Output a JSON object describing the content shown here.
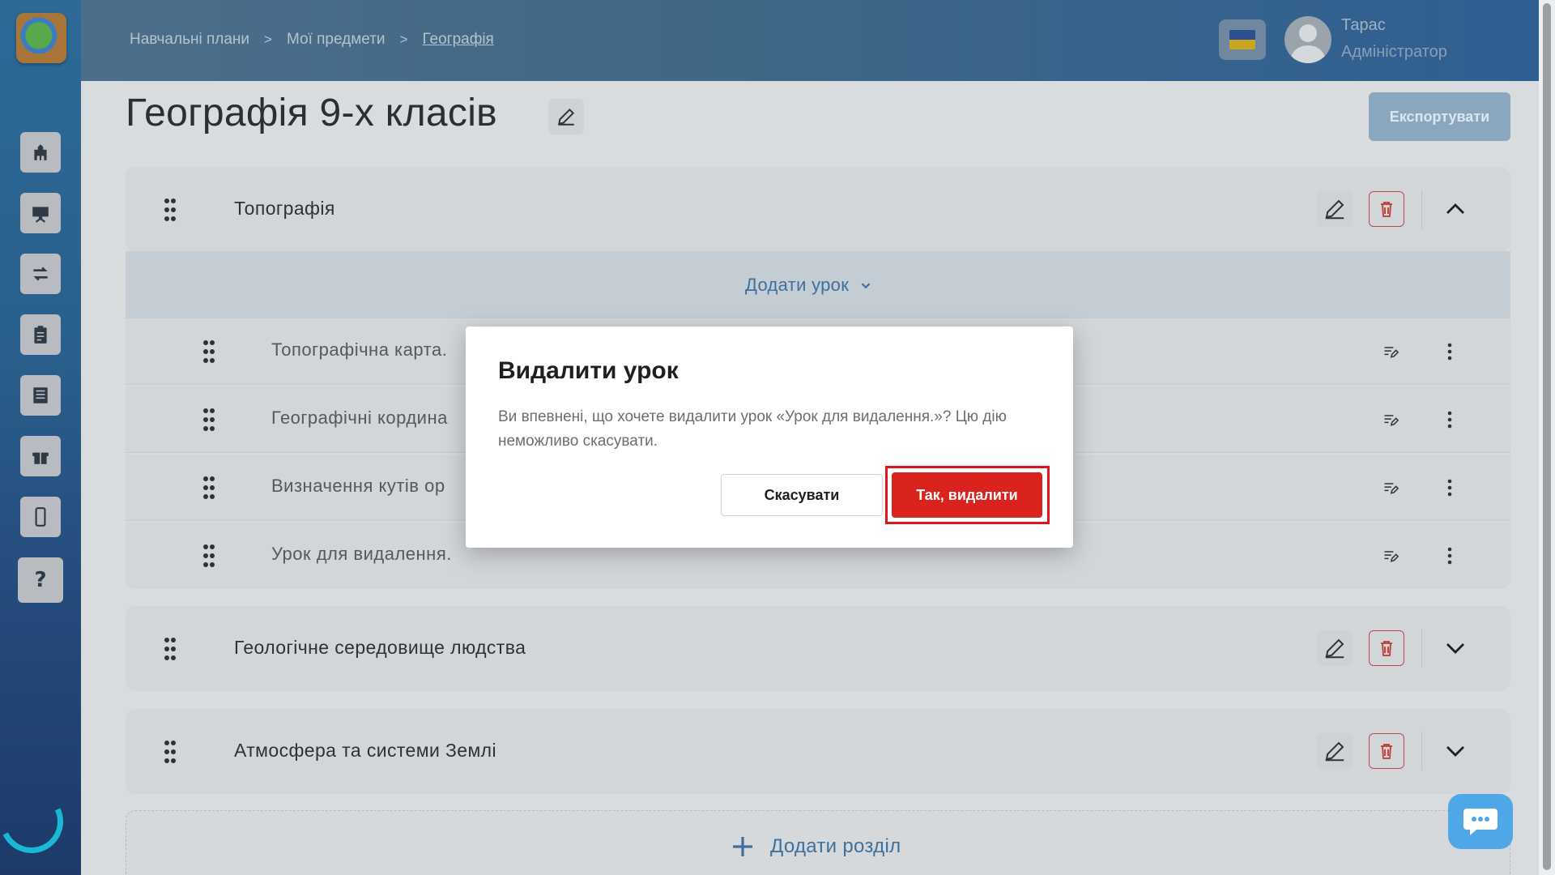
{
  "breadcrumb": {
    "item1": "Навчальні плани",
    "item2": "Мої предмети",
    "current": "Географія",
    "separator": ">"
  },
  "user": {
    "name": "Тарас",
    "role": "Адміністратор"
  },
  "page": {
    "title": "Географія 9-х класів",
    "export_label": "Експортувати"
  },
  "sections": [
    {
      "title": "Топографія",
      "expanded": true
    },
    {
      "title": "Геологічне середовище людства",
      "expanded": false
    },
    {
      "title": "Атмосфера та системи Землі",
      "expanded": false
    }
  ],
  "add_lesson_label": "Додати урок",
  "lessons": [
    {
      "title": "Топографічна карта."
    },
    {
      "title": "Географічні кордина"
    },
    {
      "title": "Визначення кутів ор"
    },
    {
      "title": "Урок для видалення."
    }
  ],
  "add_section_label": "Додати розділ",
  "modal": {
    "title": "Видалити урок",
    "message": "Ви впевнені, що хочете видалити урок «Урок для видалення.»? Цю дію неможливо скасувати.",
    "cancel_label": "Скасувати",
    "confirm_label": "Так, видалити"
  },
  "colors": {
    "accent": "#3f6f9c",
    "danger": "#d9231c",
    "highlight": "#e0151f"
  },
  "icons": {
    "sidebar": [
      "school-icon",
      "presentation-icon",
      "transfer-icon",
      "clipboard-icon",
      "document-icon",
      "gift-icon",
      "phone-icon",
      "help-icon"
    ]
  }
}
